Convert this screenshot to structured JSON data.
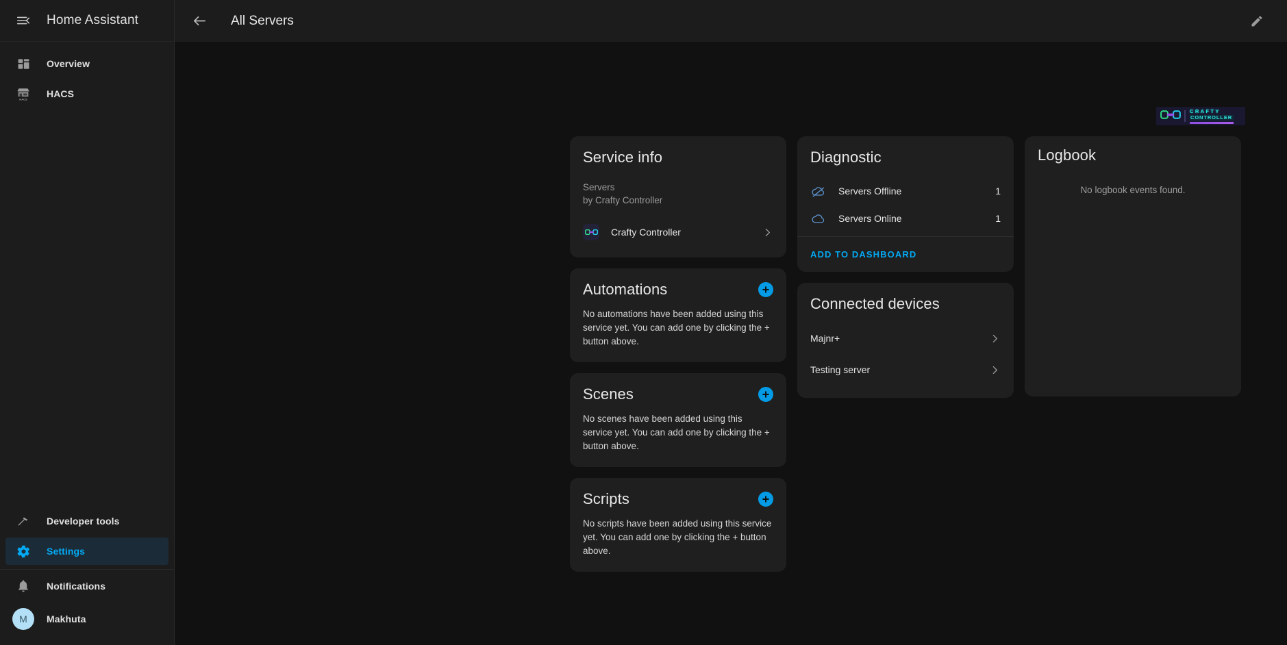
{
  "sidebar": {
    "menu_icon": "hamburger-menu-collapse-icon",
    "title": "Home Assistant",
    "items": [
      {
        "label": "Overview",
        "icon": "view-dashboard-icon",
        "active": false
      },
      {
        "label": "HACS",
        "icon": "hacs-store-icon",
        "active": false
      }
    ],
    "bottom_items": [
      {
        "label": "Developer tools",
        "icon": "hammer-icon",
        "active": false
      },
      {
        "label": "Settings",
        "icon": "gear-icon",
        "active": true
      }
    ],
    "notifications": {
      "label": "Notifications",
      "icon": "bell-icon"
    },
    "user": {
      "label": "Makhuta",
      "initial": "M"
    }
  },
  "topbar": {
    "back_icon": "arrow-left-icon",
    "title": "All Servers",
    "edit_icon": "pencil-icon"
  },
  "brand_banner": {
    "logo_icon": "crafty-link-logo-icon",
    "line1": "CRAFTY",
    "line2": "CONTROLLER"
  },
  "service_info": {
    "title": "Service info",
    "subtitle_line1": "Servers",
    "subtitle_line2": "by Crafty Controller",
    "integration_name": "Crafty Controller",
    "integration_icon": "crafty-controller-icon",
    "chevron_icon": "chevron-right-icon"
  },
  "automations": {
    "title": "Automations",
    "add_icon": "plus-circle-icon",
    "empty_text": "No automations have been added using this service yet. You can add one by clicking the + button above."
  },
  "scenes": {
    "title": "Scenes",
    "add_icon": "plus-circle-icon",
    "empty_text": "No scenes have been added using this service yet. You can add one by clicking the + button above."
  },
  "scripts": {
    "title": "Scripts",
    "add_icon": "plus-circle-icon",
    "empty_text": "No scripts have been added using this service yet. You can add one by clicking the + button above."
  },
  "diagnostic": {
    "title": "Diagnostic",
    "rows": [
      {
        "label": "Servers Offline",
        "value": "1",
        "icon": "cloud-off-icon"
      },
      {
        "label": "Servers Online",
        "value": "1",
        "icon": "cloud-icon"
      }
    ],
    "add_to_dashboard_label": "ADD TO DASHBOARD"
  },
  "connected_devices": {
    "title": "Connected devices",
    "devices": [
      {
        "name": "Majnr+",
        "chevron_icon": "chevron-right-icon"
      },
      {
        "name": "Testing server",
        "chevron_icon": "chevron-right-icon"
      }
    ]
  },
  "logbook": {
    "title": "Logbook",
    "empty_text": "No logbook events found."
  },
  "colors": {
    "accent": "#03a9f4",
    "add_button": "#039be5",
    "sidebar_bg": "#1c1c1c",
    "card_bg": "#1f1f1f",
    "page_bg": "#111111",
    "avatar_bg": "#b3e0f7"
  }
}
